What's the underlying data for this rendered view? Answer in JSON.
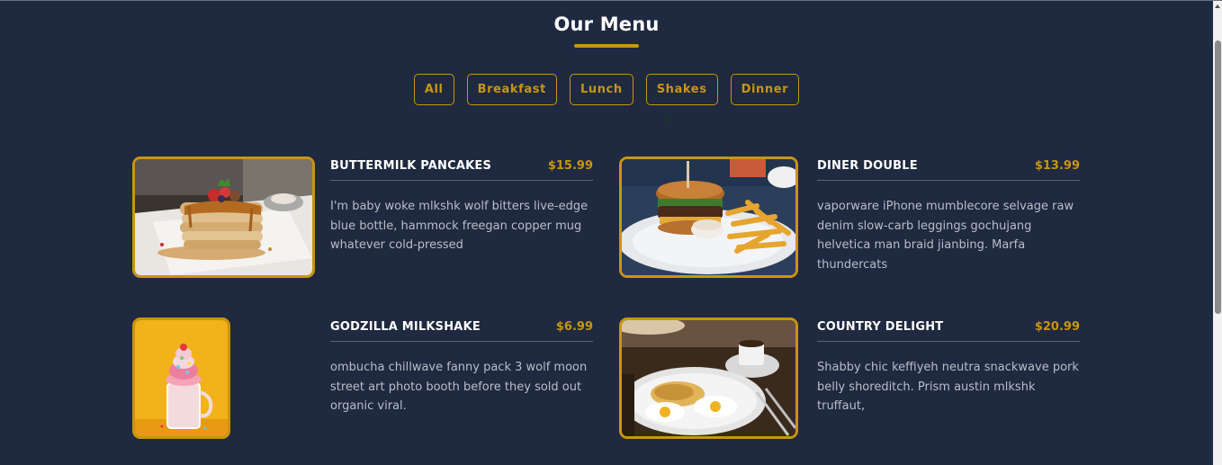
{
  "section": {
    "title": "Our Menu"
  },
  "filters": [
    "All",
    "Breakfast",
    "Lunch",
    "Shakes",
    "Dinner"
  ],
  "items": [
    {
      "name": "BUTTERMILK PANCAKES",
      "price": "$15.99",
      "description": "I'm baby woke mlkshk wolf bitters live-edge blue bottle, hammock freegan copper mug whatever cold-pressed",
      "photo": "pancakes-photo"
    },
    {
      "name": "DINER DOUBLE",
      "price": "$13.99",
      "description": "vaporware iPhone mumblecore selvage raw denim slow-carb leggings gochujang helvetica man braid jianbing. Marfa thundercats",
      "photo": "burger-photo"
    },
    {
      "name": "GODZILLA MILKSHAKE",
      "price": "$6.99",
      "description": "ombucha chillwave fanny pack 3 wolf moon street art photo booth before they sold out organic viral.",
      "photo": "milkshake-photo"
    },
    {
      "name": "COUNTRY DELIGHT",
      "price": "$20.99",
      "description": "Shabby chic keffiyeh neutra snackwave pork belly shoreditch. Prism austin mlkshk truffaut,",
      "photo": "eggs-photo"
    }
  ],
  "colors": {
    "background": "#1f2940",
    "accent": "#c8960f",
    "text": "#ffffff",
    "muted": "#b9bec8"
  }
}
